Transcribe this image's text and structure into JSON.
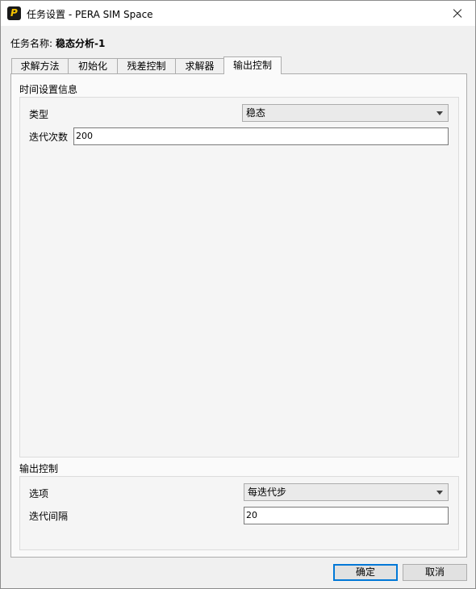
{
  "window": {
    "title": "任务设置 - PERA SIM Space",
    "icon_letter": "P",
    "icon_name": "pera-app-icon",
    "close_icon": "close-icon"
  },
  "task": {
    "name_label": "任务名称:",
    "name_value": "稳态分析-1"
  },
  "tabs": [
    {
      "label": "求解方法",
      "active": false
    },
    {
      "label": "初始化",
      "active": false
    },
    {
      "label": "残差控制",
      "active": false
    },
    {
      "label": "求解器",
      "active": false
    },
    {
      "label": "输出控制",
      "active": true
    }
  ],
  "time_settings": {
    "title": "时间设置信息",
    "type_label": "类型",
    "type_value": "稳态",
    "iterations_label": "迭代次数",
    "iterations_value": "200"
  },
  "output_control": {
    "title": "输出控制",
    "option_label": "选项",
    "option_value": "每迭代步",
    "interval_label": "迭代间隔",
    "interval_value": "20"
  },
  "buttons": {
    "ok": "确定",
    "cancel": "取消"
  }
}
